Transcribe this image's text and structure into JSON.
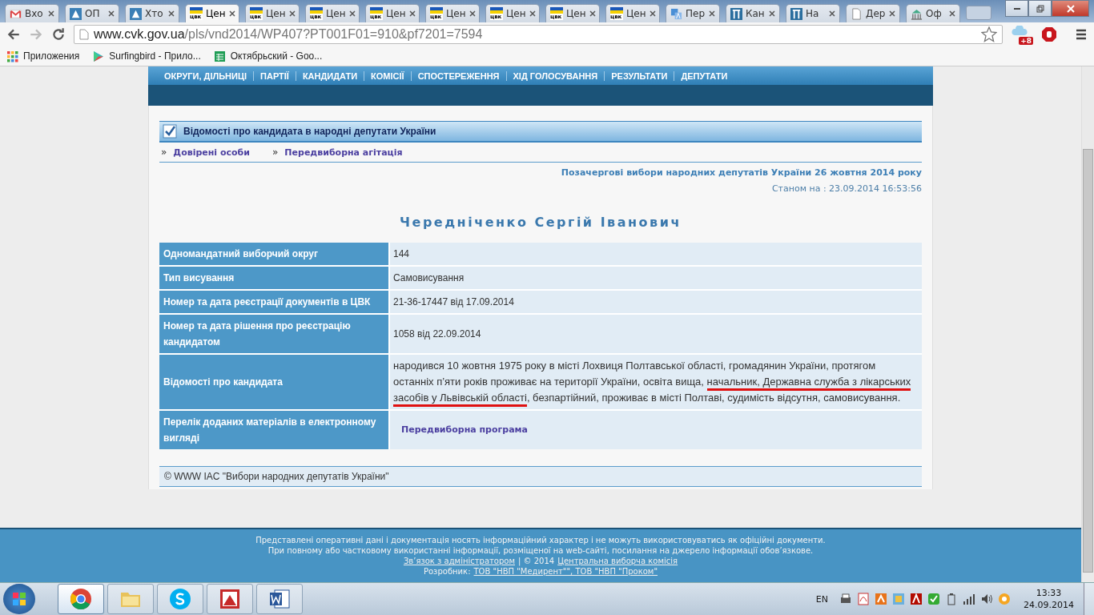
{
  "browser": {
    "tabs": [
      {
        "label": "Вхо",
        "kind": "mail",
        "selected": false
      },
      {
        "label": "ОП",
        "kind": "triangle",
        "selected": false
      },
      {
        "label": "Хто",
        "kind": "triangle",
        "selected": false
      },
      {
        "label": "Цен",
        "kind": "flag",
        "favicon_text": "цвк",
        "selected": true
      },
      {
        "label": "Цен",
        "kind": "flag",
        "favicon_text": "цвк",
        "selected": false
      },
      {
        "label": "Цен",
        "kind": "flag",
        "favicon_text": "цвк",
        "selected": false
      },
      {
        "label": "Цен",
        "kind": "flag",
        "favicon_text": "цвк",
        "selected": false
      },
      {
        "label": "Цен",
        "kind": "flag",
        "favicon_text": "цвк",
        "selected": false
      },
      {
        "label": "Цен",
        "kind": "flag",
        "favicon_text": "цвк",
        "selected": false
      },
      {
        "label": "Цен",
        "kind": "flag",
        "favicon_text": "цвк",
        "selected": false
      },
      {
        "label": "Цен",
        "kind": "flag",
        "favicon_text": "цвк",
        "selected": false
      },
      {
        "label": "Пер",
        "kind": "translate",
        "selected": false
      },
      {
        "label": "Кан",
        "kind": "pillars",
        "selected": false
      },
      {
        "label": "На",
        "kind": "pillars",
        "selected": false
      },
      {
        "label": "Дер",
        "kind": "doc",
        "selected": false
      },
      {
        "label": "Оф",
        "kind": "building",
        "selected": false
      }
    ],
    "address": {
      "domain": "www.cvk.gov.ua",
      "path": "/pls/vnd2014/WP407?PT001F01=910&pf7201=7594"
    },
    "extension_badge": "+8",
    "bookmarks": [
      {
        "label": "Приложения",
        "kind": "apps"
      },
      {
        "label": "Surfingbird - Прило...",
        "kind": "play"
      },
      {
        "label": "Октябрьский - Goo...",
        "kind": "sheet"
      }
    ]
  },
  "nav": {
    "items": [
      "ОКРУГИ, ДІЛЬНИЦІ",
      "ПАРТІЇ",
      "КАНДИДАТИ",
      "КОМІСІЇ",
      "СПОСТЕРЕЖЕННЯ",
      "ХІД ГОЛОСУВАННЯ",
      "РЕЗУЛЬТАТИ",
      "ДЕПУТАТИ"
    ]
  },
  "section": {
    "title": "Відомості про кандидата в народні депутати України",
    "link_marker": "»",
    "links": [
      "Довірені особи",
      "Передвиборна агітація"
    ]
  },
  "election": "Позачергові вибори народних депутатів України 26 жовтня 2014 року",
  "status": "Станом на : 23.09.2014 16:53:56",
  "candidate": "Чередніченко Сергій Іванович",
  "table": {
    "rows": [
      {
        "label": "Одномандатний виборчий округ",
        "kind": "text",
        "value": "144"
      },
      {
        "label": "Тип висування",
        "kind": "text",
        "value": "Самовисування"
      },
      {
        "label": "Номер та дата реєстрації документів в ЦВК",
        "kind": "text",
        "value": "21-36-17447 від 17.09.2014"
      },
      {
        "label": "Номер та дата рішення про реєстрацію кандидатом",
        "kind": "text",
        "value": "1058 від 22.09.2014"
      },
      {
        "label": "Відомості про кандидата",
        "kind": "segments",
        "segments": [
          {
            "text": "народився 10 жовтня 1975 року в місті Лохвиця Полтавської області, громадянин України, протягом останніх п’яти років проживає на території України, освіта вища, ",
            "marked": false
          },
          {
            "text": "начальник, Державна служба з лікарських засобів у Львівській області",
            "marked": true
          },
          {
            "text": ", безпартійний, проживає в місті Полтаві, судимість відсутня, самовисування.",
            "marked": false
          }
        ]
      },
      {
        "label": "Перелік доданих матеріалів в електронному вигляді",
        "kind": "link",
        "value": "Передвиборна програма"
      }
    ]
  },
  "copyright": "© WWW IAC \"Вибори народних депутатів України\"",
  "footer": {
    "lines": [
      "Представлені оперативні дані і документація носять інформаційний характер і не можуть використовуватись як офіційні документи.",
      "При повному або частковому використанні інформації, розміщеної на web-сайті, посилання на джерело інформації обов’язкове."
    ],
    "admin_link": "Зв’язок з адміністратором",
    "separator": "| © 2014",
    "cvk_link": "Центральна виборча комісія",
    "dev_label": "Розробник:",
    "dev_link": "ТОВ \"НВП \"Медирент\"\", ТОВ \"НВП \"Проком\""
  },
  "taskbar": {
    "apps": [
      {
        "kind": "chrome",
        "selected": true
      },
      {
        "kind": "folder",
        "selected": false
      },
      {
        "kind": "skype",
        "selected": false
      },
      {
        "kind": "picture",
        "selected": false
      },
      {
        "kind": "word",
        "selected": false
      }
    ],
    "language": "EN",
    "time": "13:33",
    "date": "24.09.2014"
  }
}
